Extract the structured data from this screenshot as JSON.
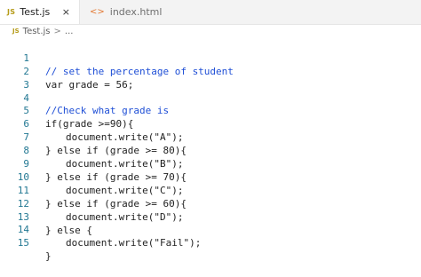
{
  "tabs": [
    {
      "icon": "JS",
      "label": "Test.js",
      "close": "×"
    },
    {
      "icon": "<>",
      "label": "index.html"
    }
  ],
  "breadcrumb": {
    "icon": "JS",
    "file": "Test.js",
    "separator": ">",
    "rest": "..."
  },
  "code": {
    "lines": [
      {
        "num": "1",
        "text": "// set the percentage of student"
      },
      {
        "num": "2",
        "text": "var grade = 56;"
      },
      {
        "num": "3",
        "text": ""
      },
      {
        "num": "4",
        "text": "//Check what grade is"
      },
      {
        "num": "5",
        "text": "if(grade >=90){"
      },
      {
        "num": "6",
        "text": "document.write(\"A\");"
      },
      {
        "num": "7",
        "text": "} else if (grade >= 80){"
      },
      {
        "num": "8",
        "text": "document.write(\"B\");"
      },
      {
        "num": "9",
        "text": "} else if (grade >= 70){"
      },
      {
        "num": "10",
        "text": "document.write(\"C\");"
      },
      {
        "num": "11",
        "text": "} else if (grade >= 60){"
      },
      {
        "num": "12",
        "text": "document.write(\"D\");"
      },
      {
        "num": "13",
        "text": "} else {"
      },
      {
        "num": "14",
        "text": "document.write(\"Fail\");"
      },
      {
        "num": "15",
        "text": "}"
      }
    ]
  }
}
